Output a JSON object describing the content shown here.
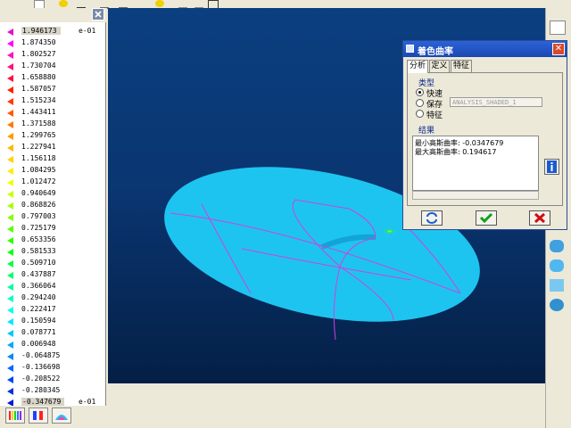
{
  "legend": {
    "values": [
      {
        "value": "1.946173",
        "color": "#e010d0",
        "exp": "e-01"
      },
      {
        "value": "1.874350",
        "color": "#ff00ff"
      },
      {
        "value": "1.802527",
        "color": "#ff10c0"
      },
      {
        "value": "1.730704",
        "color": "#ff1080"
      },
      {
        "value": "1.658880",
        "color": "#ff1040"
      },
      {
        "value": "1.587057",
        "color": "#ff2000"
      },
      {
        "value": "1.515234",
        "color": "#ff3a00"
      },
      {
        "value": "1.443411",
        "color": "#ff5a00"
      },
      {
        "value": "1.371588",
        "color": "#ff7a00"
      },
      {
        "value": "1.299765",
        "color": "#ff9a00"
      },
      {
        "value": "1.227941",
        "color": "#ffb800"
      },
      {
        "value": "1.156118",
        "color": "#ffd400"
      },
      {
        "value": "1.084295",
        "color": "#ffee00"
      },
      {
        "value": "1.012472",
        "color": "#f0ff00"
      },
      {
        "value": "0.940649",
        "color": "#ccff00"
      },
      {
        "value": "0.868826",
        "color": "#a8ff00"
      },
      {
        "value": "0.797003",
        "color": "#80ff00"
      },
      {
        "value": "0.725179",
        "color": "#58ff00"
      },
      {
        "value": "0.653356",
        "color": "#30ff00"
      },
      {
        "value": "0.581533",
        "color": "#10ff10"
      },
      {
        "value": "0.509710",
        "color": "#00ff40"
      },
      {
        "value": "0.437887",
        "color": "#00ff70"
      },
      {
        "value": "0.366064",
        "color": "#00ffa0"
      },
      {
        "value": "0.294240",
        "color": "#00ffc8"
      },
      {
        "value": "0.222417",
        "color": "#00fff0"
      },
      {
        "value": "0.150594",
        "color": "#00e8ff"
      },
      {
        "value": "0.078771",
        "color": "#00c8ff"
      },
      {
        "value": "0.006948",
        "color": "#00a8ff"
      },
      {
        "value": "-0.064875",
        "color": "#0088ff"
      },
      {
        "value": "-0.136698",
        "color": "#0068ff"
      },
      {
        "value": "-0.208522",
        "color": "#0048f0"
      },
      {
        "value": "-0.280345",
        "color": "#0030e0"
      },
      {
        "value": "-0.347679",
        "color": "#0018d0",
        "exp": "e-01"
      }
    ]
  },
  "dialog": {
    "title": "着色曲率",
    "tabs": [
      "分析",
      "定义",
      "特征"
    ],
    "type_label": "类型",
    "options": [
      "快速",
      "保存",
      "特征"
    ],
    "saved_name": "ANALYSIS_SHADED_1",
    "result_label": "结果",
    "results": [
      "最小高斯曲率: -0.0347679",
      "最大高斯曲率: 0.194617"
    ],
    "close_glyph": "✕"
  },
  "colors": {
    "viewport_top": "#0b3f80",
    "viewport_bottom": "#041f45",
    "surface": "#20c8f0",
    "surface_edges": "#d040e0",
    "title_bar": "#2d63d8"
  }
}
